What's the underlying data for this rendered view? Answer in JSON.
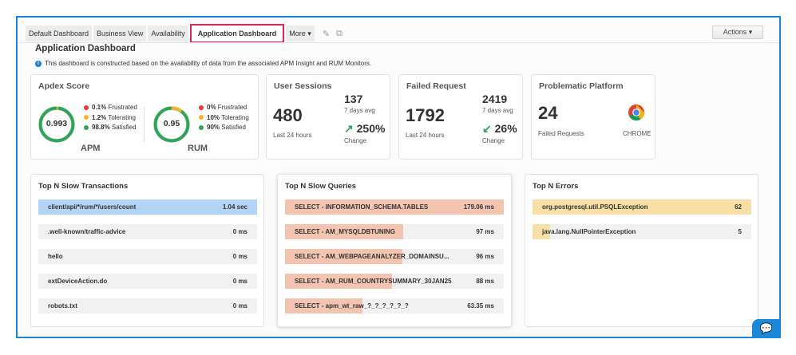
{
  "tabs": [
    {
      "label": "Default Dashboard"
    },
    {
      "label": "Business View"
    },
    {
      "label": "Availability"
    },
    {
      "label": "Application Dashboard",
      "active": true
    },
    {
      "label": "More ▾"
    }
  ],
  "actions_label": "Actions ▾",
  "page_title": "Application Dashboard",
  "info_text": "This dashboard is constructed based on the availability of data from the associated APM Insight and RUM Monitors.",
  "colors": {
    "accent": "#1a88d8",
    "highlight": "#e0245e",
    "frustrated": "#e53935",
    "tolerating": "#f5b324",
    "satisfied": "#2ea55a",
    "transactions_bar": "#b3d4f5",
    "queries_bar": "#f3c4b0",
    "errors_bar": "#f7dfa6"
  },
  "apdex": {
    "title": "Apdex Score",
    "apm": {
      "label": "APM",
      "score": "0.993",
      "frustrated": "0.1%",
      "tolerating": "1.2%",
      "satisfied": "98.8%",
      "tolerating_frac": 0.012
    },
    "rum": {
      "label": "RUM",
      "score": "0.95",
      "frustrated": "0%",
      "tolerating": "10%",
      "satisfied": "90%",
      "tolerating_frac": 0.1
    },
    "frustrated_label": "Frustrated",
    "tolerating_label": "Tolerating",
    "satisfied_label": "Satisfied"
  },
  "user_sessions": {
    "title": "User Sessions",
    "value": "480",
    "period": "Last 24 hours",
    "avg": "137",
    "avg_label": "7 days avg",
    "change": "250%",
    "change_dir": "up",
    "change_label": "Change"
  },
  "failed_request": {
    "title": "Failed Request",
    "value": "1792",
    "period": "Last 24 hours",
    "avg": "2419",
    "avg_label": "7 days avg",
    "change": "26%",
    "change_dir": "down",
    "change_label": "Change"
  },
  "platform": {
    "title": "Problematic Platform",
    "value": "24",
    "label": "Failed Requests",
    "browser": "CHROME",
    "icon": "chrome-icon"
  },
  "transactions": {
    "title": "Top N Slow Transactions",
    "rows": [
      {
        "name": "client/api/*/rum/*/users/count",
        "value": "1.04 sec",
        "frac": 1
      },
      {
        "name": ".well-known/traffic-advice",
        "value": "0 ms",
        "frac": 0
      },
      {
        "name": "hello",
        "value": "0 ms",
        "frac": 0
      },
      {
        "name": "extDeviceAction.do",
        "value": "0 ms",
        "frac": 0
      },
      {
        "name": "robots.txt",
        "value": "0 ms",
        "frac": 0
      }
    ]
  },
  "queries": {
    "title": "Top N Slow Queries",
    "rows": [
      {
        "name": "SELECT  -  INFORMATION_SCHEMA.TABLES",
        "value": "179.06 ms",
        "frac": 1
      },
      {
        "name": "SELECT  -  AM_MYSQLDBTUNING",
        "value": "97 ms",
        "frac": 0.54
      },
      {
        "name": "SELECT  -  AM_WEBPAGEANALYZER_DOMAINSU...",
        "value": "96 ms",
        "frac": 0.536
      },
      {
        "name": "SELECT  -  AM_RUM_COUNTRYSUMMARY_30JAN25",
        "value": "88 ms",
        "frac": 0.49
      },
      {
        "name": "SELECT  -  apm_wt_raw_?_?_?_?_?_?",
        "value": "63.35 ms",
        "frac": 0.354
      }
    ]
  },
  "errors": {
    "title": "Top N Errors",
    "rows": [
      {
        "name": "org.postgresql.util.PSQLException",
        "value": "62",
        "frac": 1
      },
      {
        "name": "java.lang.NullPointerException",
        "value": "5",
        "frac": 0.08
      }
    ]
  }
}
